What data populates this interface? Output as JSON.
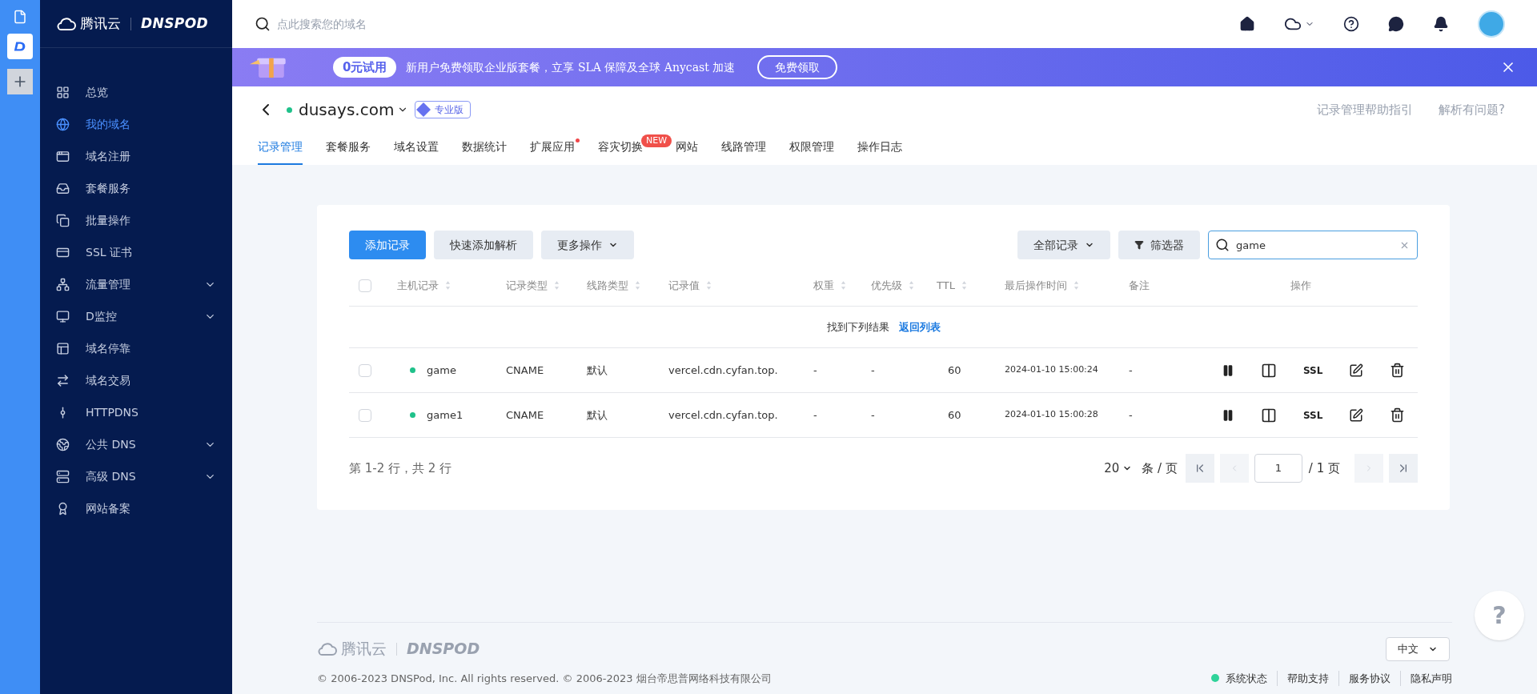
{
  "brand": {
    "cloud_name": "腾讯云",
    "product": "DNSPOD"
  },
  "sidebar": {
    "items": [
      {
        "label": "总览",
        "selected": false,
        "kind": "link"
      },
      {
        "label": "我的域名",
        "selected": true,
        "kind": "link"
      },
      {
        "label": "域名注册",
        "selected": false,
        "kind": "link"
      },
      {
        "label": "套餐服务",
        "selected": false,
        "kind": "link"
      },
      {
        "label": "批量操作",
        "selected": false,
        "kind": "link"
      },
      {
        "label": "SSL 证书",
        "selected": false,
        "kind": "link"
      },
      {
        "label": "流量管理",
        "selected": false,
        "kind": "group"
      },
      {
        "label": "D监控",
        "selected": false,
        "kind": "group"
      },
      {
        "label": "域名停靠",
        "selected": false,
        "kind": "link"
      },
      {
        "label": "域名交易",
        "selected": false,
        "kind": "link"
      },
      {
        "label": "HTTPDNS",
        "selected": false,
        "kind": "link"
      },
      {
        "label": "公共 DNS",
        "selected": false,
        "kind": "group"
      },
      {
        "label": "高级 DNS",
        "selected": false,
        "kind": "group"
      },
      {
        "label": "网站备案",
        "selected": false,
        "kind": "link"
      }
    ]
  },
  "topbar": {
    "search_placeholder": "点此搜索您的域名"
  },
  "banner": {
    "badge": "0元试用",
    "text": "新用户免费领取企业版套餐，立享 SLA 保障及全球 Anycast 加速",
    "button": "免费领取"
  },
  "domain": {
    "name": "dusays.com",
    "enabled": true,
    "plan": "专业版",
    "links": [
      "记录管理帮助指引",
      "解析有问题?"
    ]
  },
  "tabs": [
    {
      "label": "记录管理",
      "selected": true
    },
    {
      "label": "套餐服务",
      "selected": false
    },
    {
      "label": "域名设置",
      "selected": false
    },
    {
      "label": "数据统计",
      "selected": false
    },
    {
      "label": "扩展应用",
      "selected": false,
      "dot": true
    },
    {
      "label": "容灾切换",
      "selected": false,
      "badge": "NEW"
    },
    {
      "label": "网站",
      "selected": false
    },
    {
      "label": "线路管理",
      "selected": false
    },
    {
      "label": "权限管理",
      "selected": false
    },
    {
      "label": "操作日志",
      "selected": false
    }
  ],
  "toolbar": {
    "left": [
      {
        "label": "添加记录",
        "kind": "primary"
      },
      {
        "label": "快速添加解析",
        "kind": "plain"
      },
      {
        "label": "更多操作",
        "kind": "dropdown"
      }
    ],
    "right": [
      {
        "label": "全部记录",
        "kind": "dropdown"
      },
      {
        "label": "筛选器",
        "kind": "filter"
      }
    ],
    "search_value": "game"
  },
  "table": {
    "select_all_checked": false,
    "columns": [
      {
        "label": "主机记录",
        "sortable": true
      },
      {
        "label": "记录类型",
        "sortable": true
      },
      {
        "label": "线路类型",
        "sortable": true
      },
      {
        "label": "记录值",
        "sortable": true
      },
      {
        "label": "权重",
        "sortable": true
      },
      {
        "label": "优先级",
        "sortable": true
      },
      {
        "label": "TTL",
        "sortable": true
      },
      {
        "label": "最后操作时间",
        "sortable": true
      },
      {
        "label": "备注",
        "sortable": false
      },
      {
        "label": "操作",
        "sortable": false
      }
    ],
    "notice": {
      "text": "找到下列结果",
      "link": "返回列表"
    },
    "rows": [
      {
        "checked": false,
        "enabled": true,
        "host": "game",
        "type": "CNAME",
        "line": "默认",
        "value": "vercel.cdn.cyfan.top.",
        "weight": "-",
        "priority": "-",
        "ttl": "60",
        "time": "2024-01-10 15:00:24",
        "remark": "-",
        "ssl": "SSL"
      },
      {
        "checked": false,
        "enabled": true,
        "host": "game1",
        "type": "CNAME",
        "line": "默认",
        "value": "vercel.cdn.cyfan.top.",
        "weight": "-",
        "priority": "-",
        "ttl": "60",
        "time": "2024-01-10 15:00:28",
        "remark": "-",
        "ssl": "SSL"
      }
    ]
  },
  "pagination": {
    "summary": "第 1-2 行，共 2 行",
    "page_size": "20",
    "unit": "条 / 页",
    "page": "1",
    "total": "/ 1 页"
  },
  "footer": {
    "cloud_name": "腾讯云",
    "product": "DNSPOD",
    "copyright": "© 2006-2023 DNSPod, Inc. All rights reserved. © 2006-2023 烟台帝思普网络科技有限公司",
    "language": "中文",
    "status": {
      "label": "系统状态",
      "color": "#2fd39a"
    },
    "links": [
      "帮助支持",
      "服务协议",
      "隐私声明"
    ]
  },
  "help_button": "?"
}
